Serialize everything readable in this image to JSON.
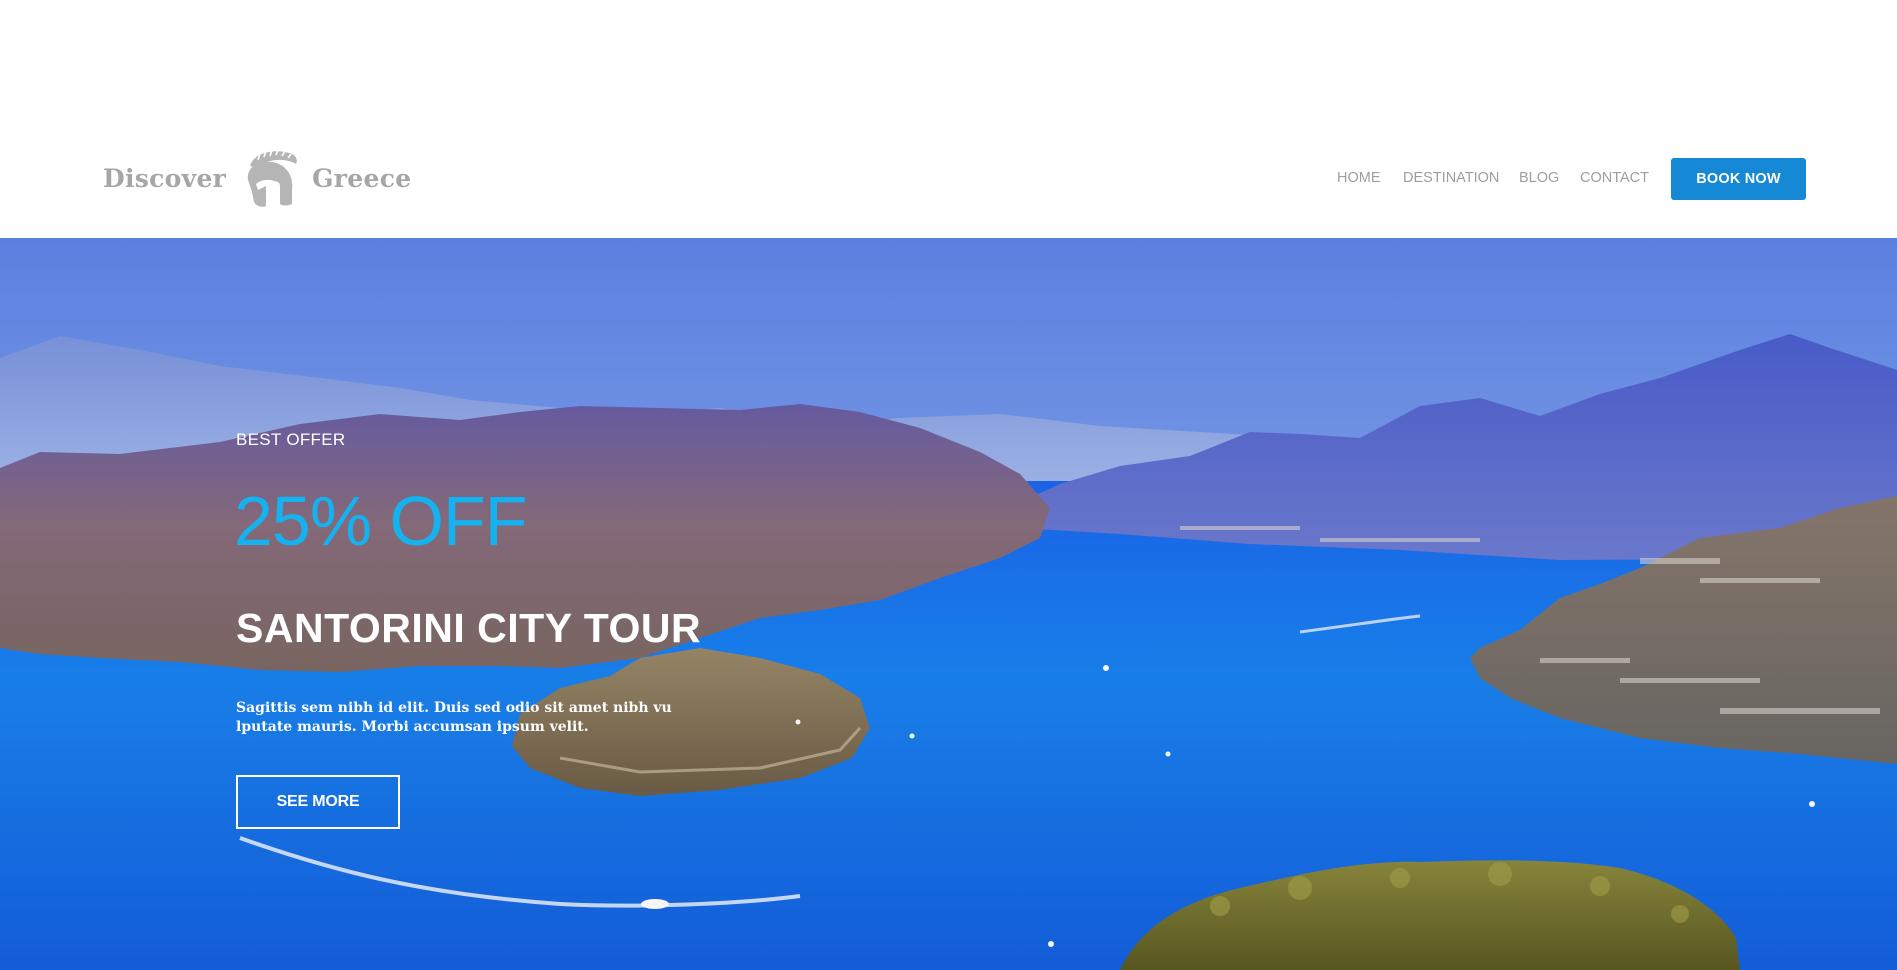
{
  "header": {
    "logo": {
      "left_word": "Discover",
      "right_word": "Greece",
      "icon": "spartan-helmet-icon"
    },
    "nav": {
      "items": [
        {
          "label": "HOME"
        },
        {
          "label": "DESTINATION"
        },
        {
          "label": "BLOG"
        },
        {
          "label": "CONTACT"
        }
      ],
      "cta_label": "BOOK NOW"
    }
  },
  "hero": {
    "eyebrow": "BEST OFFER",
    "discount": "25% OFF",
    "title": "SANTORINI CITY TOUR",
    "description": "Sagittis sem nibh id elit. Duis sed odio sit amet nibh vu lputate mauris. Morbi accumsan ipsum velit.",
    "cta_label": "SEE MORE"
  },
  "colors": {
    "accent": "#1589d6",
    "discount": "#14b2ef",
    "logo_gray": "#a6a6a6",
    "nav_gray": "#9e9e9e"
  }
}
